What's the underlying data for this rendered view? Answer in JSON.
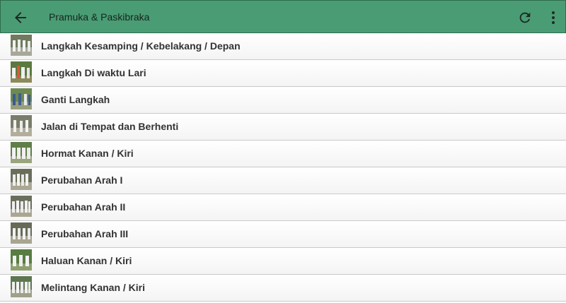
{
  "app": {
    "title": "Pramuka & Paskibraka",
    "bar_color": "#4a9c75"
  },
  "icons": {
    "back": "arrow-back-icon",
    "refresh": "refresh-icon",
    "more": "more-vertical-icon"
  },
  "items": [
    {
      "label": "Langkah Kesamping / Kebelakang / Depan"
    },
    {
      "label": "Langkah Di waktu Lari"
    },
    {
      "label": "Ganti Langkah"
    },
    {
      "label": "Jalan di Tempat dan Berhenti"
    },
    {
      "label": "Hormat Kanan / Kiri"
    },
    {
      "label": "Perubahan Arah I"
    },
    {
      "label": "Perubahan Arah II"
    },
    {
      "label": "Perubahan Arah III"
    },
    {
      "label": "Haluan Kanan / Kiri"
    },
    {
      "label": "Melintang Kanan / Kiri"
    }
  ]
}
